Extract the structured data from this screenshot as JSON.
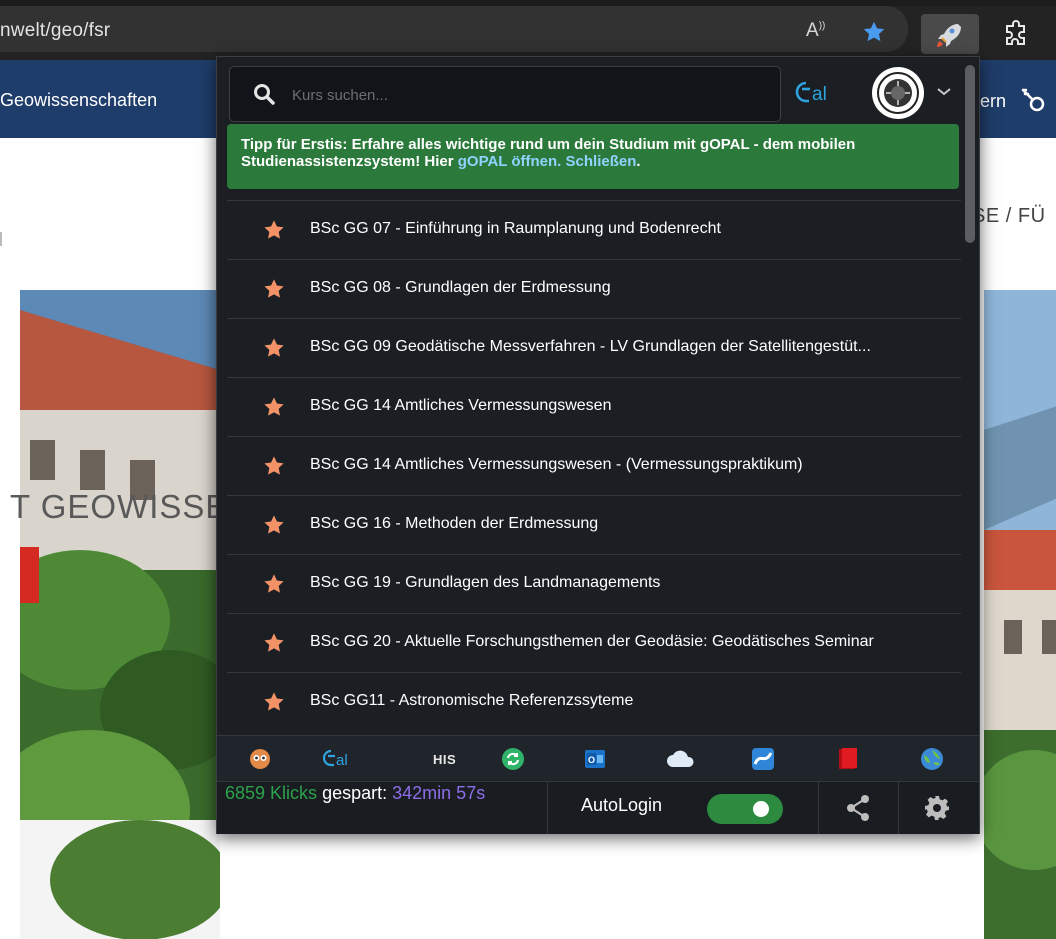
{
  "browser": {
    "address": "nwelt/geo/fsr",
    "read_aloud_label": "A¹¹"
  },
  "site": {
    "nav_title": "Geowissenschaften",
    "nav_right": "ern",
    "breadcrumb_right": "SE / FÜ",
    "hero_heading": "T GEOWISSE"
  },
  "popup": {
    "search": {
      "placeholder": "Kurs suchen..."
    },
    "opal_logo_text": "Opal",
    "tip": {
      "text": "Tipp für Erstis: Erfahre alles wichtige rund um dein Studium mit gOPAL - dem mobilen Studienassistenzsystem! Hier ",
      "open_link": "gOPAL öffnen.",
      "close_link": "Schließen",
      "end": "."
    },
    "courses": [
      "BSc GG 07 - Einführung in Raumplanung und Bodenrecht",
      "BSc GG 08 - Grundlagen der Erdmessung",
      "BSc GG 09 Geodätische Messverfahren - LV Grundlagen der Satellitengestüt...",
      "BSc GG 14 Amtliches Vermessungswesen",
      "BSc GG 14 Amtliches Vermessungswesen - (Vermessungspraktikum)",
      "BSc GG 16 - Methoden der Erdmessung",
      "BSc GG 19 - Grundlagen des Landmanagements",
      "BSc GG 20 - Aktuelle Forschungsthemen der Geodäsie: Geodätisches Seminar",
      "BSc GG11 - Astronomische Referenzssyteme"
    ],
    "toolbar": {
      "his_label": "HIS",
      "icons": [
        "owl-icon",
        "opal-icon",
        "his-icon",
        "sync-icon",
        "outlook-icon",
        "cloud-icon",
        "matrix-icon",
        "book-icon",
        "globe-icon"
      ]
    },
    "status": {
      "clicks": "6859 Klicks",
      "saved_word": "gespart:",
      "time": "342min 57s",
      "autologin_label": "AutoLogin",
      "autologin_on": true
    }
  },
  "colors": {
    "accent_green": "#2c7a3b",
    "star_orange": "#f39267",
    "link_blue": "#8fd3ff",
    "popup_bg": "#1b1f24",
    "site_nav": "#1f3d6a"
  }
}
